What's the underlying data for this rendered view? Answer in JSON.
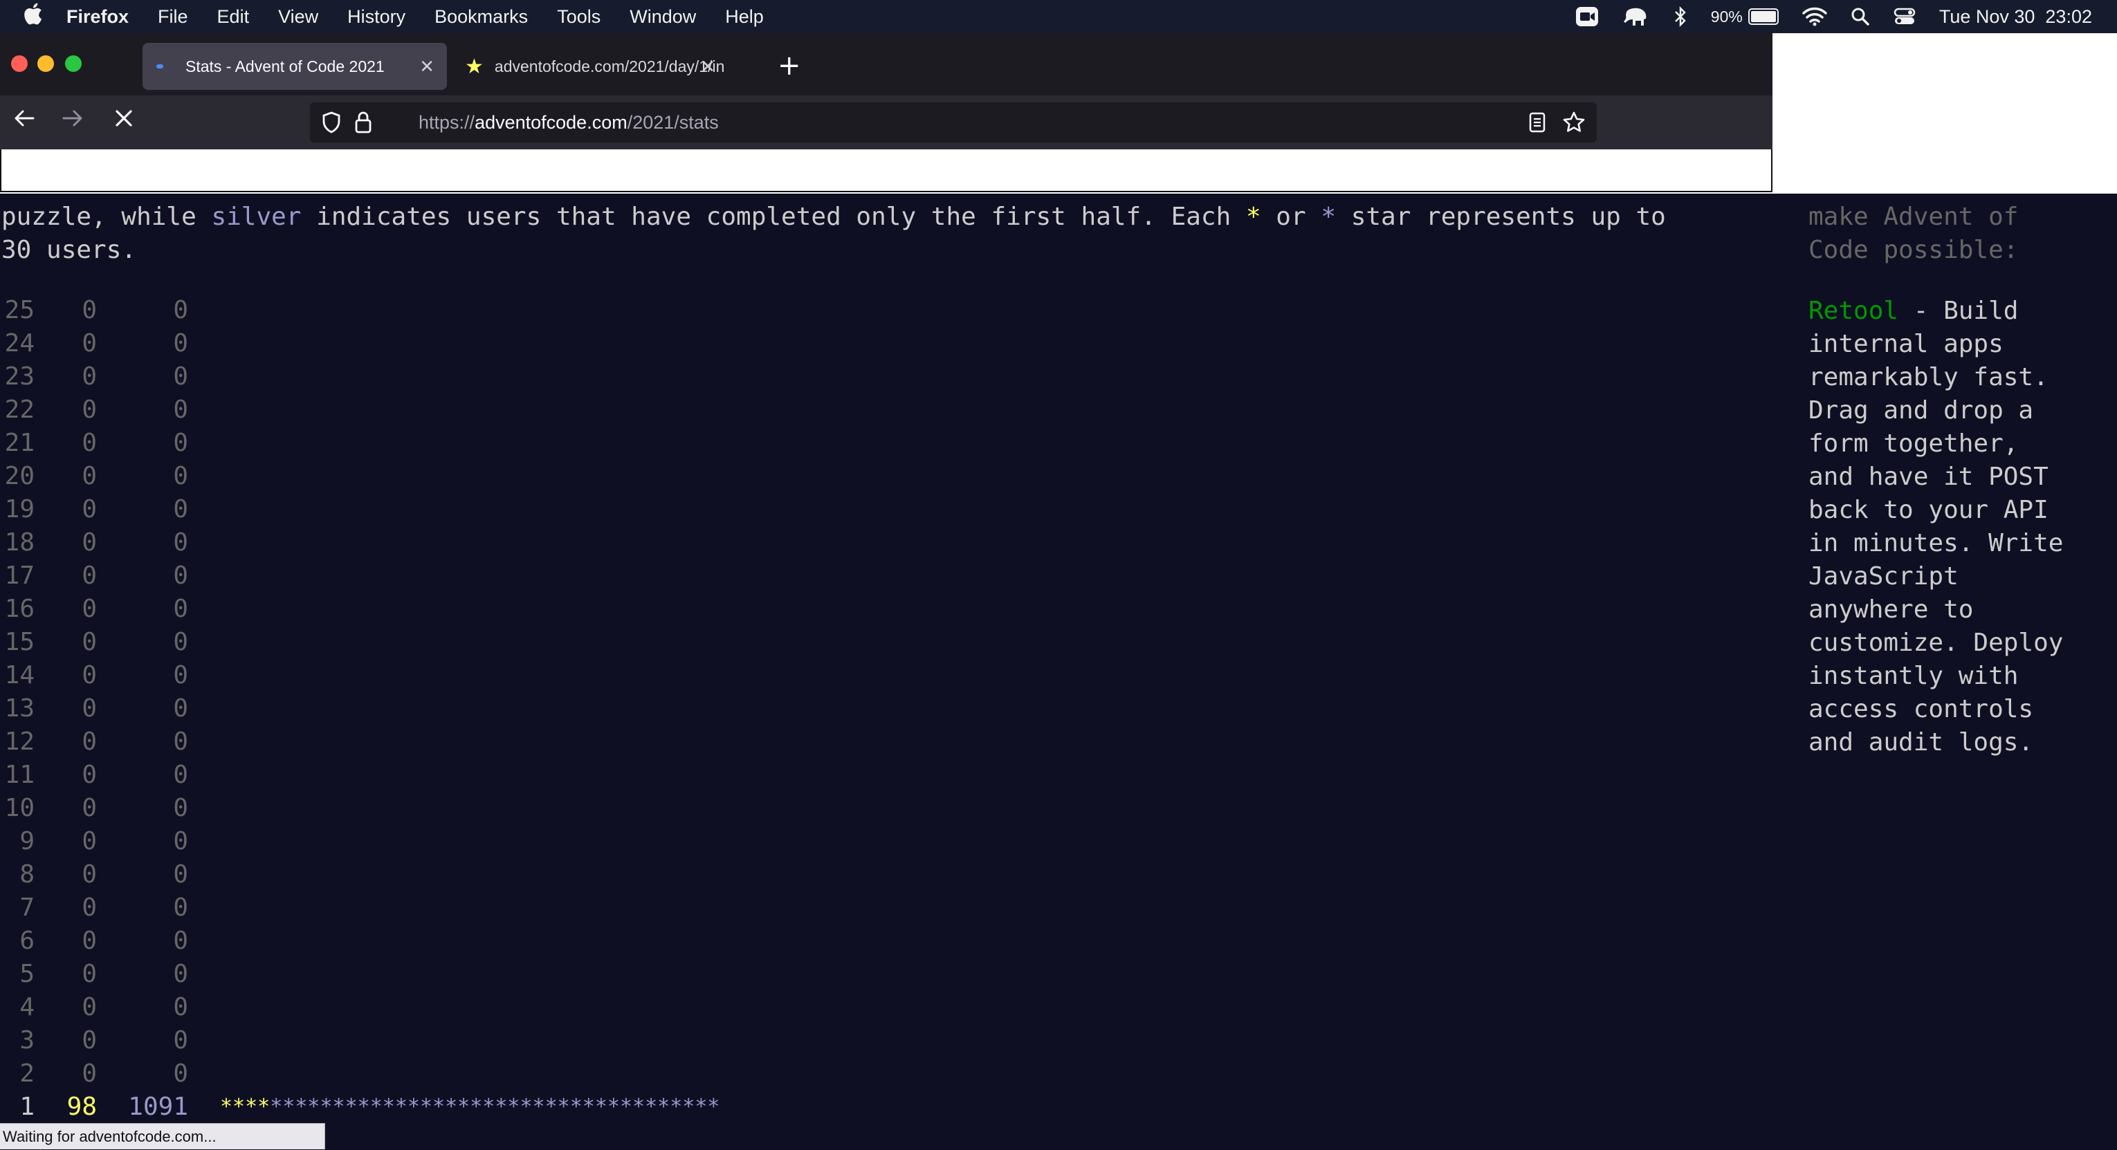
{
  "menubar": {
    "apple_icon": "apple-icon",
    "app": "Firefox",
    "menus": [
      "File",
      "Edit",
      "View",
      "History",
      "Bookmarks",
      "Tools",
      "Window",
      "Help"
    ],
    "battery": "90%",
    "battery_level": 0.9,
    "clock": "Tue Nov 30  23:02"
  },
  "tabs": [
    {
      "title": "Stats - Advent of Code 2021"
    },
    {
      "title": "adventofcode.com/2021/day/1/in"
    }
  ],
  "url": {
    "scheme": "https://",
    "host": "adventofcode.com",
    "path": "/2021/stats"
  },
  "intro": {
    "line1_start": "puzzle, while ",
    "silver_word": "silver",
    "line1_mid": " indicates users that have completed only the first half. Each ",
    "gold_star": "*",
    "or_text": " or ",
    "silver_star": "*",
    "line1_end": " star represents up to",
    "line2": "30 users."
  },
  "stats": [
    {
      "day": "25",
      "gold": "0",
      "silver": "0"
    },
    {
      "day": "24",
      "gold": "0",
      "silver": "0"
    },
    {
      "day": "23",
      "gold": "0",
      "silver": "0"
    },
    {
      "day": "22",
      "gold": "0",
      "silver": "0"
    },
    {
      "day": "21",
      "gold": "0",
      "silver": "0"
    },
    {
      "day": "20",
      "gold": "0",
      "silver": "0"
    },
    {
      "day": "19",
      "gold": "0",
      "silver": "0"
    },
    {
      "day": "18",
      "gold": "0",
      "silver": "0"
    },
    {
      "day": "17",
      "gold": "0",
      "silver": "0"
    },
    {
      "day": "16",
      "gold": "0",
      "silver": "0"
    },
    {
      "day": "15",
      "gold": "0",
      "silver": "0"
    },
    {
      "day": "14",
      "gold": "0",
      "silver": "0"
    },
    {
      "day": "13",
      "gold": "0",
      "silver": "0"
    },
    {
      "day": "12",
      "gold": "0",
      "silver": "0"
    },
    {
      "day": "11",
      "gold": "0",
      "silver": "0"
    },
    {
      "day": "10",
      "gold": "0",
      "silver": "0"
    },
    {
      "day": "9",
      "gold": "0",
      "silver": "0"
    },
    {
      "day": "8",
      "gold": "0",
      "silver": "0"
    },
    {
      "day": "7",
      "gold": "0",
      "silver": "0"
    },
    {
      "day": "6",
      "gold": "0",
      "silver": "0"
    },
    {
      "day": "5",
      "gold": "0",
      "silver": "0"
    },
    {
      "day": "4",
      "gold": "0",
      "silver": "0"
    },
    {
      "day": "3",
      "gold": "0",
      "silver": "0"
    },
    {
      "day": "2",
      "gold": "0",
      "silver": "0"
    },
    {
      "day": "1",
      "gold": "98",
      "silver": "1091",
      "gold_bar": "****",
      "silver_bar": "************************************"
    }
  ],
  "sponsor": {
    "top1": "make Advent of",
    "top2": "Code possible:",
    "name": "Retool",
    "lines": [
      " - Build",
      "internal apps",
      "remarkably fast.",
      "Drag and drop a",
      "form together,",
      "and have it POST",
      "back to your API",
      "in minutes. Write",
      "JavaScript",
      "anywhere to",
      "customize. Deploy",
      "instantly with",
      "access controls",
      "and audit logs."
    ]
  },
  "status": "Waiting for adventofcode.com...",
  "colors": {
    "page_bg": "#0f0f23",
    "gold": "#ffff66",
    "silver": "#9999cc",
    "text": "#cccccc",
    "dim": "#666666",
    "sponsor": "#009900"
  }
}
